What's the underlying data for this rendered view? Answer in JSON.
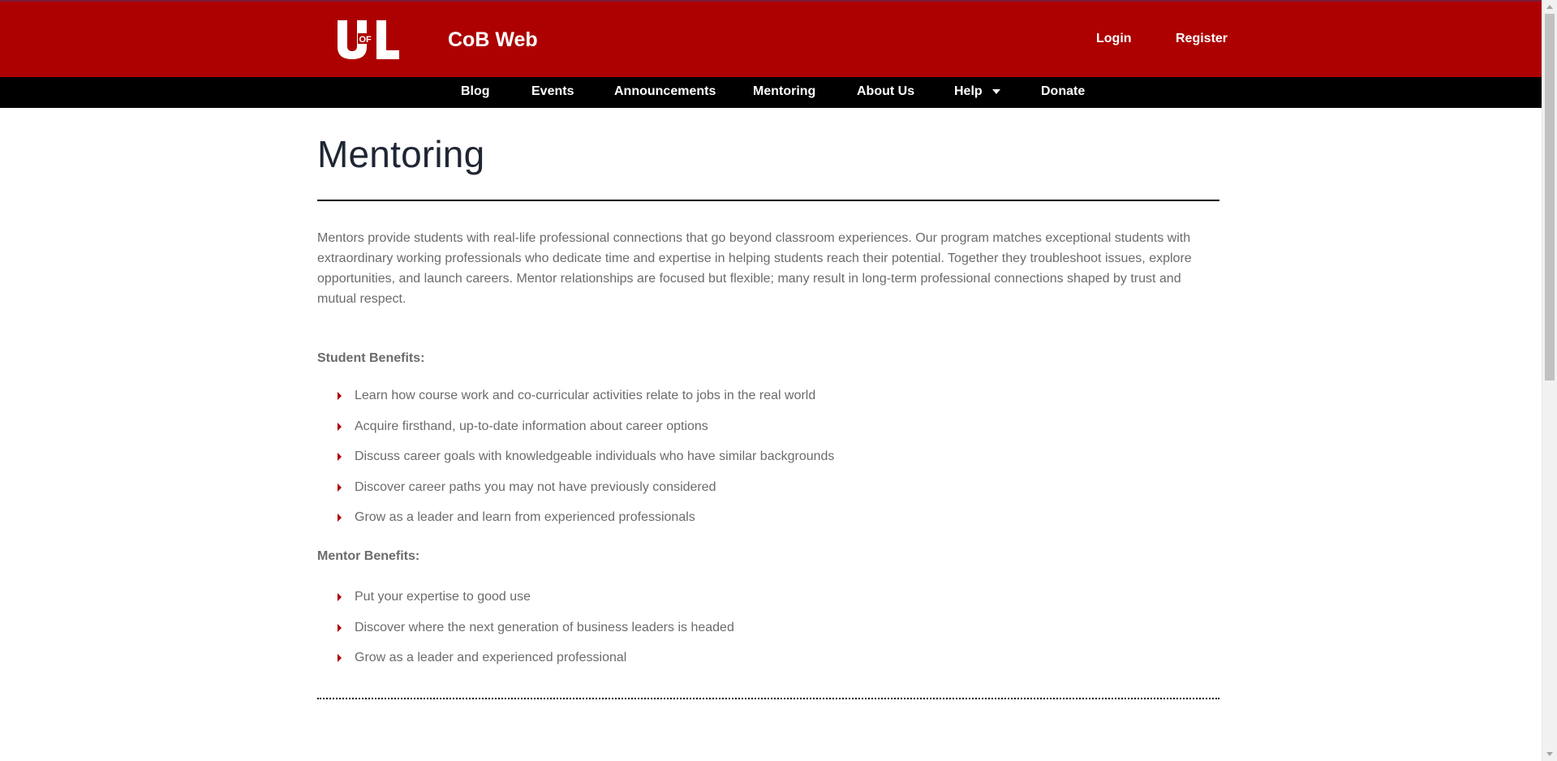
{
  "site": {
    "title": "CoB Web",
    "logo_text": "UofL",
    "brand_color": "#ad0000"
  },
  "auth": {
    "login": "Login",
    "register": "Register"
  },
  "nav": {
    "items": [
      {
        "label": "Blog"
      },
      {
        "label": "Events"
      },
      {
        "label": "Announcements"
      },
      {
        "label": "Mentoring"
      },
      {
        "label": "About Us"
      },
      {
        "label": "Help",
        "icon": "caret-down-icon"
      },
      {
        "label": "Donate"
      }
    ]
  },
  "page": {
    "title": "Mentoring",
    "intro": "Mentors provide students with real-life professional connections that go beyond classroom experiences. Our program matches exceptional students with extraordinary working professionals who dedicate time and expertise in helping students reach their potential. Together they troubleshoot issues, explore opportunities, and launch careers. Mentor relationships are focused but flexible; many result in long-term professional connections shaped by trust and mutual respect.",
    "student_heading": "Student Benefits:",
    "student_benefits": [
      "Learn how course work and co-curricular activities relate to jobs in the real world",
      "Acquire firsthand, up-to-date information about career options",
      "Discuss career goals with knowledgeable individuals who have similar backgrounds",
      "Discover career paths you may not have previously considered",
      "Grow as a leader and learn from experienced professionals"
    ],
    "mentor_heading": "Mentor Benefits:",
    "mentor_benefits": [
      "Put your expertise to good use",
      "Discover where the next generation of business leaders is headed",
      "Grow as a leader and experienced professional"
    ]
  }
}
